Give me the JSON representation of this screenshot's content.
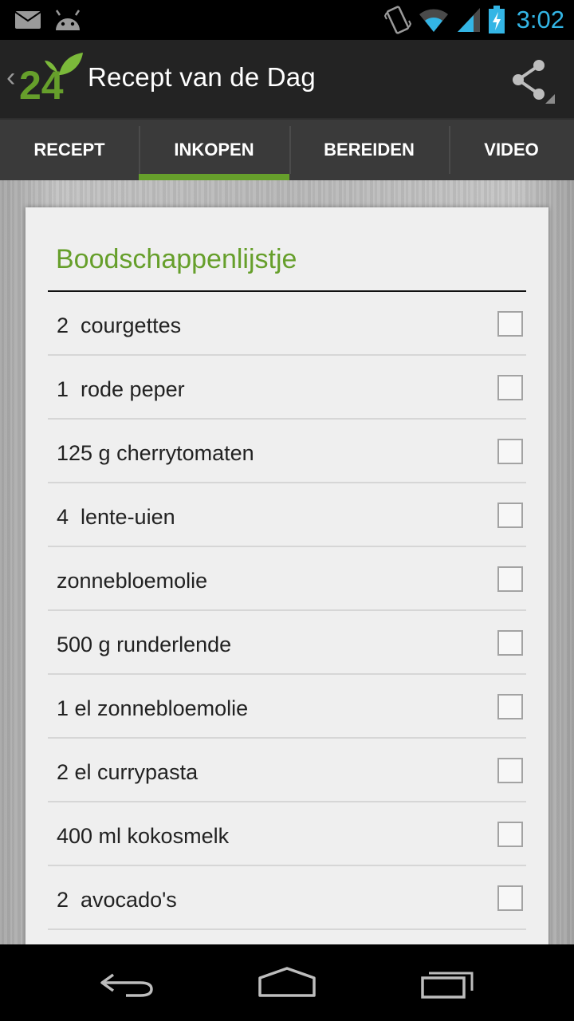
{
  "status_bar": {
    "time": "3:02",
    "left_icons": [
      "mail-icon",
      "android-icon"
    ],
    "right_icons": [
      "vibrate-icon",
      "wifi-icon",
      "signal-icon",
      "battery-charging-icon"
    ]
  },
  "action_bar": {
    "title": "Recept van de Dag",
    "logo_text": "24",
    "share_icon": "share-icon"
  },
  "tabs": [
    {
      "label": "RECEPT",
      "active": false
    },
    {
      "label": "INKOPEN",
      "active": true
    },
    {
      "label": "BEREIDEN",
      "active": false
    },
    {
      "label": "VIDEO",
      "active": false
    }
  ],
  "shopping_list": {
    "title": "Boodschappenlijstje",
    "items": [
      {
        "label": "2  courgettes",
        "checked": false
      },
      {
        "label": "1  rode peper",
        "checked": false
      },
      {
        "label": "125 g cherrytomaten",
        "checked": false
      },
      {
        "label": "4  lente-uien",
        "checked": false
      },
      {
        "label": "zonnebloemolie",
        "checked": false
      },
      {
        "label": "500 g runderlende",
        "checked": false
      },
      {
        "label": "1 el zonnebloemolie",
        "checked": false
      },
      {
        "label": "2 el currypasta",
        "checked": false
      },
      {
        "label": "400 ml kokosmelk",
        "checked": false
      },
      {
        "label": "2  avocado's",
        "checked": false
      }
    ]
  },
  "colors": {
    "accent": "#669f2b",
    "clock": "#33b5e5",
    "action_bar": "#232323",
    "tab_bar": "#3a3a3a"
  },
  "nav_bar": {
    "icons": [
      "back-icon",
      "home-icon",
      "recent-apps-icon"
    ]
  }
}
